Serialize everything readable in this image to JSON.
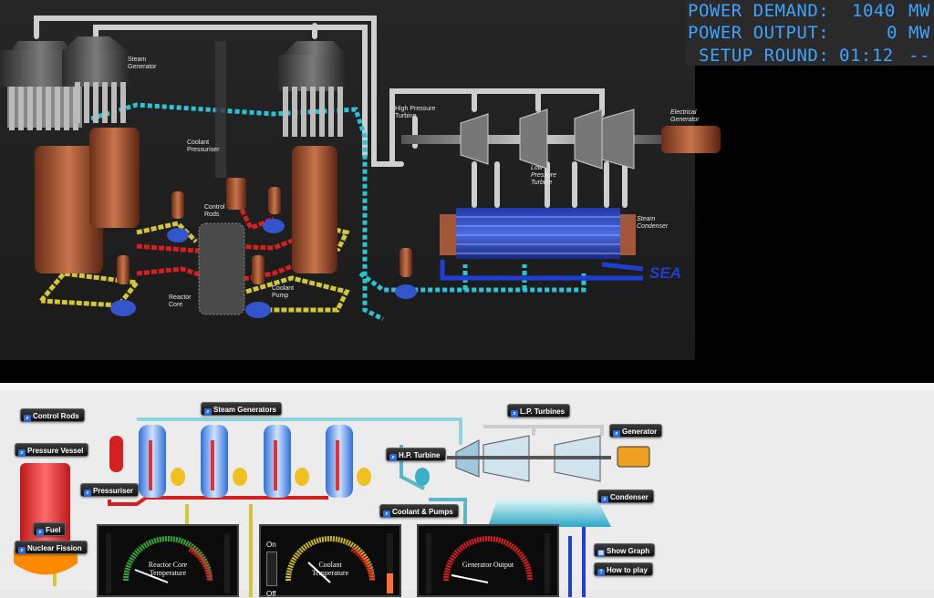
{
  "hud": {
    "demand_label": "POWER DEMAND:",
    "demand_value": "1040",
    "output_label": "POWER OUTPUT:",
    "output_value": "0",
    "unit": "MW",
    "setup_label": "SETUP ROUND:",
    "setup_value": "01:12",
    "setup_suffix": "--"
  },
  "scene_labels": {
    "steam_generator": "Steam Generator",
    "coolant_pressuriser": "Coolant Pressuriser",
    "control_rods": "Control Rods",
    "reactor_core": "Reactor Core",
    "coolant_pump": "Coolant Pump",
    "high_pressure_turbine": "High Pressure Turbine",
    "electrical_generator": "Electrical Generator",
    "low_pressure_turbine": "Low Pressure Turbine",
    "steam_condenser": "Steam Condenser",
    "sea": "SEA"
  },
  "buttons": {
    "control_rods": "Control Rods",
    "pressure_vessel": "Pressure Vessel",
    "pressuriser": "Pressuriser",
    "fuel": "Fuel",
    "nuclear_fission": "Nuclear Fission",
    "steam_generators": "Steam Generators",
    "hp_turbine": "H.P. Turbine",
    "coolant_pumps": "Coolant & Pumps",
    "lp_turbines": "L.P. Turbines",
    "generator": "Generator",
    "condenser": "Condenser",
    "show_graph": "Show Graph",
    "how_to_play": "How to play"
  },
  "gauges": {
    "reactor_core_temp": "Reactor Core Temperature",
    "coolant_temp": "Coolant Temperature",
    "generator_output": "Generator Output",
    "switch_on": "On",
    "switch_off": "Off"
  },
  "colors": {
    "hud_text": "#3fa3ff",
    "coolant_loop": "#d4c63a",
    "hot_loop": "#d62020",
    "steam_line": "#2bc4d4",
    "sea_water": "#1e3fd6",
    "button_icon": "#2e6bd8"
  },
  "icons": {
    "button": "magnifier-icon",
    "show_graph": "graph-icon",
    "how_to_play": "question-icon"
  }
}
